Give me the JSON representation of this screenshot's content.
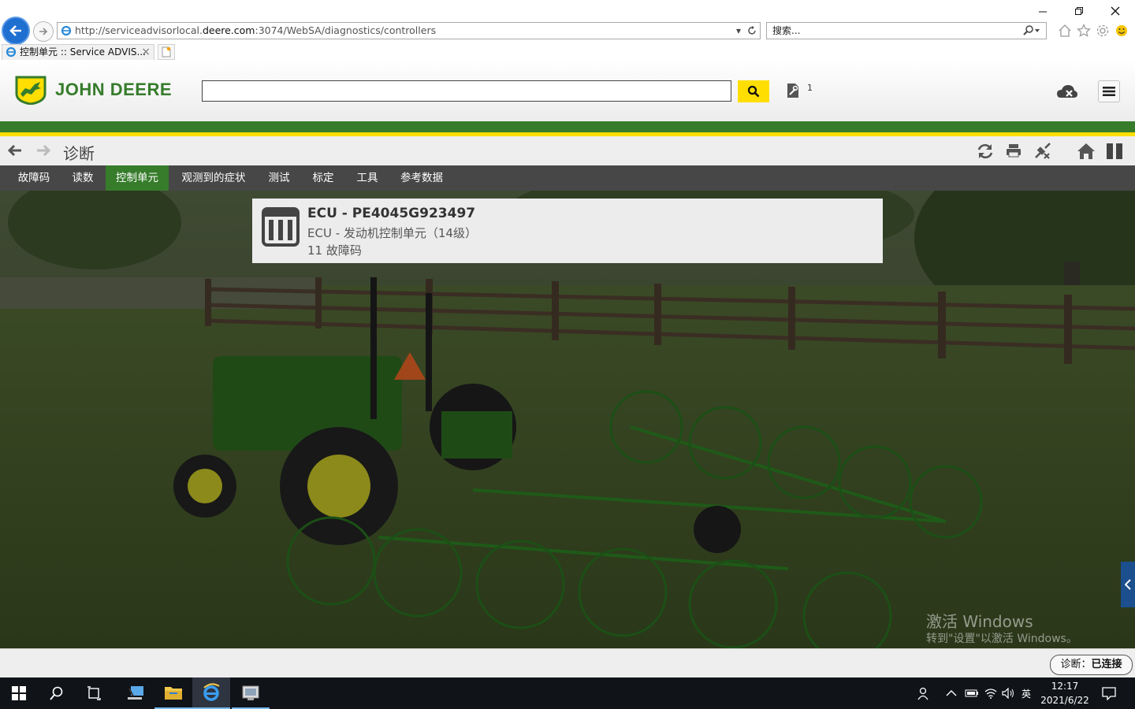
{
  "browser": {
    "url_prefix": "http://serviceadvisorlocal.",
    "url_host": "deere.com",
    "url_suffix": ":3074/WebSA/diagnostics/controllers",
    "search_placeholder": "搜索...",
    "tab_title": "控制单元 :: Service ADVIS...",
    "tab_close": "×"
  },
  "header": {
    "logo_text": "JOHN DEERE",
    "search_value": "",
    "badge_count": "1",
    "brand_colors": {
      "green": "#367c2b",
      "yellow": "#ffde00"
    }
  },
  "titlebar": {
    "title": "诊断"
  },
  "menu": {
    "tabs": [
      "故障码",
      "读数",
      "控制单元",
      "观测到的症状",
      "测试",
      "标定",
      "工具",
      "参考数据"
    ],
    "active_index": 2
  },
  "ecu_card": {
    "title": "ECU - PE4045G923497",
    "subtitle": "ECU - 发动机控制单元（14级）",
    "fault_count": "11 故障码",
    "icon": "controller-icon"
  },
  "watermark": {
    "line1": "激活 Windows",
    "line2": "转到\"设置\"以激活 Windows。"
  },
  "status": {
    "label": "诊断：",
    "value": "已连接"
  },
  "taskbar": {
    "ime": "英",
    "time": "12:17",
    "date": "2021/6/22"
  }
}
